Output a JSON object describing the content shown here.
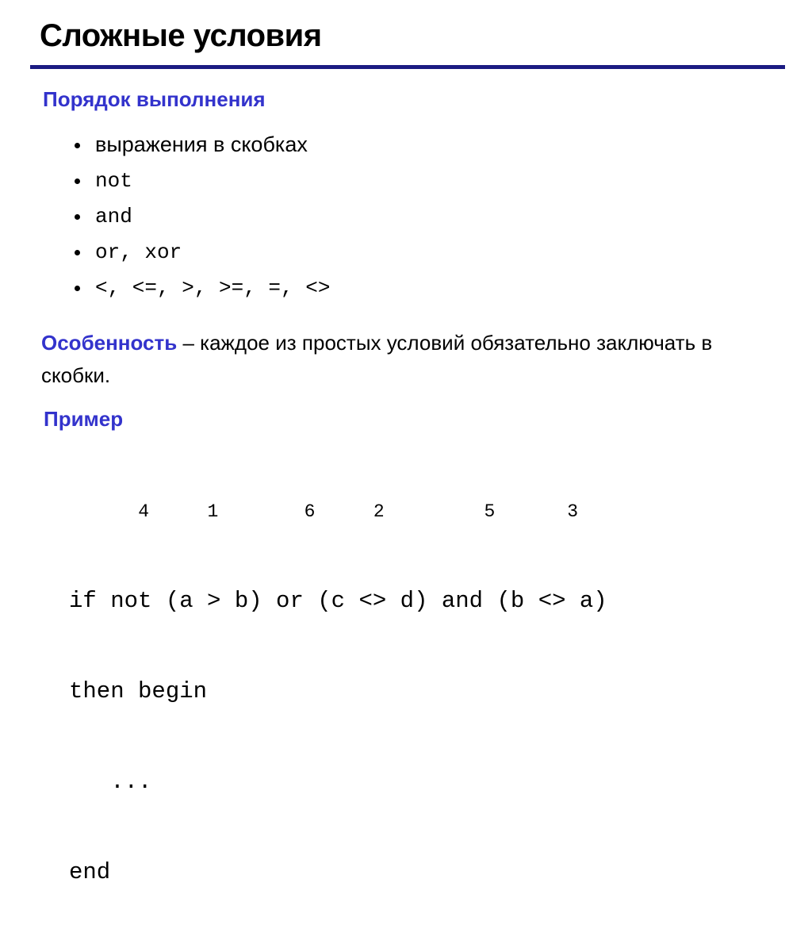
{
  "slide": {
    "title": "Сложные условия",
    "accent_blue": "#3333CC",
    "rule_color": "#1B1B82",
    "background": "#FFFFFF",
    "text_color": "#000000"
  },
  "order_section": {
    "heading": "Порядок выполнения",
    "items": [
      {
        "text": "выражения в скобках",
        "style": "sans"
      },
      {
        "text": "not",
        "style": "mono"
      },
      {
        "text": "and",
        "style": "mono"
      },
      {
        "text": "or, xor",
        "style": "mono"
      },
      {
        "text": "<, <=, >, >=, =, <>",
        "style": "mono"
      }
    ]
  },
  "feature_section": {
    "lead": "Особенность",
    "rest": " – каждое из простых условий обязательно заключать в скобки."
  },
  "example_section": {
    "heading": "Пример",
    "order_numbers": [
      {
        "label": "4",
        "column": 5
      },
      {
        "label": "1",
        "column": 10
      },
      {
        "label": "6",
        "column": 17
      },
      {
        "label": "2",
        "column": 22
      },
      {
        "label": "5",
        "column": 30
      },
      {
        "label": "3",
        "column": 36
      }
    ],
    "code_lines": [
      "if not (a > b) or (c <> d) and (b <> a)",
      "then begin",
      "   ...",
      "end"
    ]
  }
}
